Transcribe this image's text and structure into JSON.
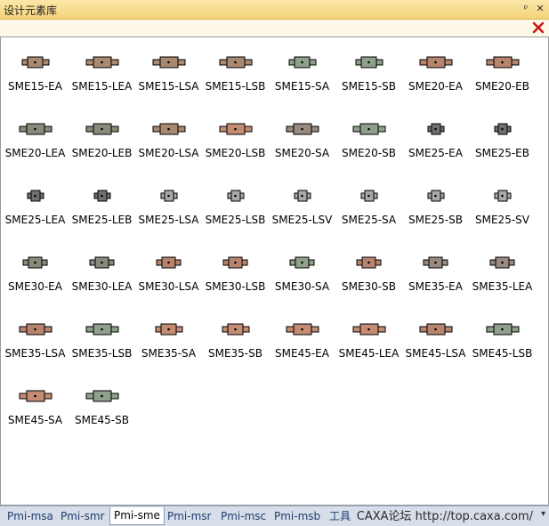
{
  "window": {
    "title": "设计元素库",
    "pin_icon": "pin-icon",
    "close_icon": "close-icon"
  },
  "panel_close_icon": "red-x-close-icon",
  "items": [
    {
      "label": "SME15-EA",
      "color": "#a9896f",
      "w": 0.5
    },
    {
      "label": "SME15-LEA",
      "color": "#a9896f",
      "w": 0.6
    },
    {
      "label": "SME15-LSA",
      "color": "#a9896f",
      "w": 0.6
    },
    {
      "label": "SME15-LSB",
      "color": "#a9896f",
      "w": 0.6
    },
    {
      "label": "SME15-SA",
      "color": "#8fa08c",
      "w": 0.5
    },
    {
      "label": "SME15-SB",
      "color": "#8fa08c",
      "w": 0.5
    },
    {
      "label": "SME20-EA",
      "color": "#b7856e",
      "w": 0.6
    },
    {
      "label": "SME20-EB",
      "color": "#b7856e",
      "w": 0.6
    },
    {
      "label": "SME20-LEA",
      "color": "#8a8a7a",
      "w": 0.6
    },
    {
      "label": "SME20-LEB",
      "color": "#8a8a7a",
      "w": 0.6
    },
    {
      "label": "SME20-LSA",
      "color": "#a9896f",
      "w": 0.6
    },
    {
      "label": "SME20-LSB",
      "color": "#c48c72",
      "w": 0.6
    },
    {
      "label": "SME20-SA",
      "color": "#9a8a80",
      "w": 0.6
    },
    {
      "label": "SME20-SB",
      "color": "#8fa08c",
      "w": 0.6
    },
    {
      "label": "SME25-EA",
      "color": "#707070",
      "w": 0.3
    },
    {
      "label": "SME25-EB",
      "color": "#707070",
      "w": 0.3
    },
    {
      "label": "SME25-LEA",
      "color": "#707070",
      "w": 0.3
    },
    {
      "label": "SME25-LEB",
      "color": "#707070",
      "w": 0.3
    },
    {
      "label": "SME25-LSA",
      "color": "#a9a9a9",
      "w": 0.3
    },
    {
      "label": "SME25-LSB",
      "color": "#a9a9a9",
      "w": 0.3
    },
    {
      "label": "SME25-LSV",
      "color": "#a9a9a9",
      "w": 0.3
    },
    {
      "label": "SME25-SA",
      "color": "#a9a9a9",
      "w": 0.3
    },
    {
      "label": "SME25-SB",
      "color": "#a9a9a9",
      "w": 0.3
    },
    {
      "label": "SME25-SV",
      "color": "#a9a9a9",
      "w": 0.3
    },
    {
      "label": "SME30-EA",
      "color": "#8a8a7a",
      "w": 0.45
    },
    {
      "label": "SME30-LEA",
      "color": "#8a8a7a",
      "w": 0.45
    },
    {
      "label": "SME30-LSA",
      "color": "#b7856e",
      "w": 0.45
    },
    {
      "label": "SME30-LSB",
      "color": "#b7856e",
      "w": 0.45
    },
    {
      "label": "SME30-SA",
      "color": "#8fa08c",
      "w": 0.45
    },
    {
      "label": "SME30-SB",
      "color": "#b7856e",
      "w": 0.45
    },
    {
      "label": "SME35-EA",
      "color": "#9a8a80",
      "w": 0.45
    },
    {
      "label": "SME35-LEA",
      "color": "#9a8a80",
      "w": 0.45
    },
    {
      "label": "SME35-LSA",
      "color": "#b7856e",
      "w": 0.6
    },
    {
      "label": "SME35-LSB",
      "color": "#8fa08c",
      "w": 0.6
    },
    {
      "label": "SME35-SA",
      "color": "#c48c72",
      "w": 0.5
    },
    {
      "label": "SME35-SB",
      "color": "#c48c72",
      "w": 0.5
    },
    {
      "label": "SME45-EA",
      "color": "#c48c72",
      "w": 0.6
    },
    {
      "label": "SME45-LEA",
      "color": "#c48c72",
      "w": 0.6
    },
    {
      "label": "SME45-LSA",
      "color": "#b7856e",
      "w": 0.6
    },
    {
      "label": "SME45-LSB",
      "color": "#8fa08c",
      "w": 0.6
    },
    {
      "label": "SME45-SA",
      "color": "#c48c72",
      "w": 0.6
    },
    {
      "label": "SME45-SB",
      "color": "#8fa08c",
      "w": 0.6
    }
  ],
  "tabs": [
    {
      "label": "Pmi-msa",
      "active": false
    },
    {
      "label": "Pmi-smr",
      "active": false
    },
    {
      "label": "Pmi-sme",
      "active": true
    },
    {
      "label": "Pmi-msr",
      "active": false
    },
    {
      "label": "Pmi-msc",
      "active": false
    },
    {
      "label": "Pmi-msb",
      "active": false
    },
    {
      "label": "工具",
      "active": false
    }
  ],
  "footer": {
    "watermark": "CAXA论坛 http://top.caxa.com/",
    "scroll_icon": "chevron-down-icon"
  }
}
